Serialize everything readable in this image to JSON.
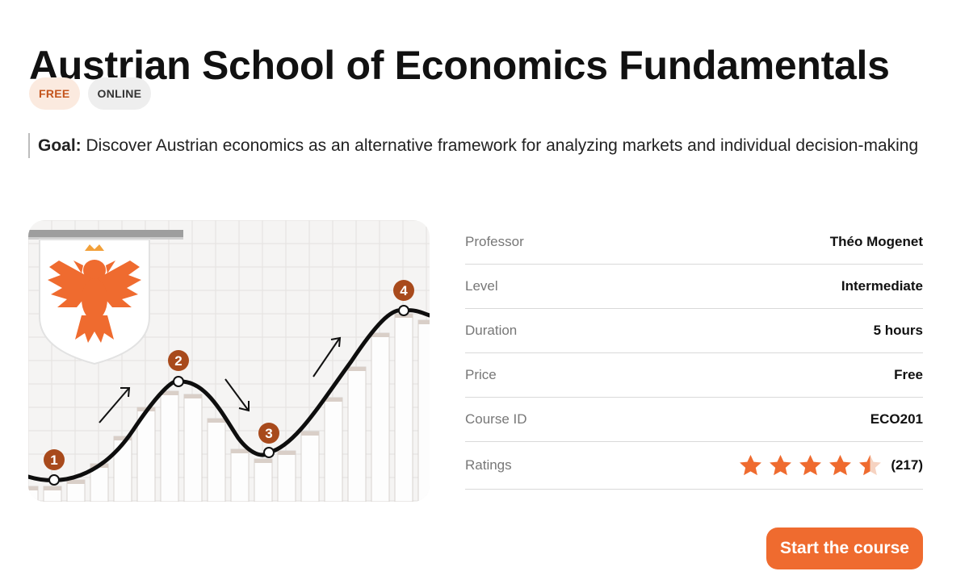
{
  "course": {
    "title": "Austrian School of Economics Fundamentals",
    "badges": [
      "FREE",
      "ONLINE"
    ],
    "goal_label": "Goal:",
    "goal_text": "Discover Austrian economics as an alternative framework for analyzing markets and individual decision-making"
  },
  "illustration": {
    "markers": [
      "1",
      "2",
      "3",
      "4"
    ],
    "accent": "#ef6b2f",
    "marker_color": "#a84a1c",
    "emblem": "eagle-crest-icon"
  },
  "details": {
    "rows": [
      {
        "label": "Professor",
        "value": "Théo Mogenet"
      },
      {
        "label": "Level",
        "value": "Intermediate"
      },
      {
        "label": "Duration",
        "value": "5 hours"
      },
      {
        "label": "Price",
        "value": "Free"
      },
      {
        "label": "Course ID",
        "value": "ECO201"
      }
    ],
    "ratings": {
      "label": "Ratings",
      "score": 4.5,
      "max": 5,
      "count": "(217)",
      "star_color": "#ef6b2f"
    }
  },
  "cta": {
    "label": "Start the course"
  }
}
